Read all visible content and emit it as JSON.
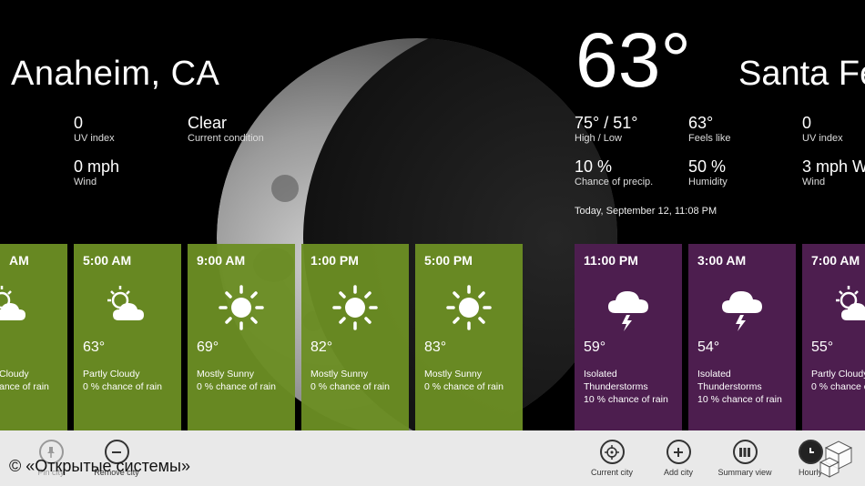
{
  "left_city": {
    "name": "Anaheim, CA",
    "uv_value": "0",
    "uv_label": "UV index",
    "condition_value": "Clear",
    "condition_label": "Current condition",
    "wind_value": "0 mph",
    "wind_label": "Wind"
  },
  "current": {
    "temperature": "63°",
    "high_low_value": "75° / 51°",
    "high_low_label": "High / Low",
    "feels_like_value": "63°",
    "feels_like_label": "Feels like",
    "precip_value": "10 %",
    "precip_label": "Chance of precip.",
    "humidity_value": "50 %",
    "humidity_label": "Humidity",
    "updated": "Today, September 12, 11:08 PM"
  },
  "right_city": {
    "name": "Santa Fe",
    "uv_value": "0",
    "uv_label": "UV index",
    "wind_value": "3 mph W",
    "wind_label": "Wind"
  },
  "left_tiles": [
    {
      "time": "AM",
      "icon": "partly-cloudy-icon",
      "temp": "",
      "line1": "Cloudy",
      "line2": "ance of rain",
      "line3": ""
    },
    {
      "time": "5:00 AM",
      "icon": "partly-cloudy-icon",
      "temp": "63°",
      "line1": "Partly Cloudy",
      "line2": "0 % chance of rain",
      "line3": ""
    },
    {
      "time": "9:00 AM",
      "icon": "sun-icon",
      "temp": "69°",
      "line1": "Mostly Sunny",
      "line2": "0 % chance of rain",
      "line3": ""
    },
    {
      "time": "1:00 PM",
      "icon": "sun-icon",
      "temp": "82°",
      "line1": "Mostly Sunny",
      "line2": "0 % chance of rain",
      "line3": ""
    },
    {
      "time": "5:00 PM",
      "icon": "sun-icon",
      "temp": "83°",
      "line1": "Mostly Sunny",
      "line2": "0 % chance of rain",
      "line3": ""
    }
  ],
  "right_tiles": [
    {
      "time": "11:00 PM",
      "icon": "thunderstorm-icon",
      "temp": "59°",
      "line1": "Isolated",
      "line2": "Thunderstorms",
      "line3": "10 % chance of rain"
    },
    {
      "time": "3:00 AM",
      "icon": "thunderstorm-icon",
      "temp": "54°",
      "line1": "Isolated",
      "line2": "Thunderstorms",
      "line3": "10 % chance of rain"
    },
    {
      "time": "7:00 AM",
      "icon": "partly-cloudy-icon",
      "temp": "55°",
      "line1": "Partly Cloudy",
      "line2": "0 % chance of",
      "line3": ""
    }
  ],
  "appbar": {
    "pin_label": "Pin city",
    "remove_label": "Remove city",
    "current_label": "Current city",
    "add_label": "Add city",
    "summary_label": "Summary view",
    "hourly_label": "Hourly"
  },
  "watermark": "© «Открытые системы»",
  "colors": {
    "tile_green": "#6b8e23",
    "tile_purple": "#4d1e4f",
    "appbar": "#e9e9e9"
  }
}
